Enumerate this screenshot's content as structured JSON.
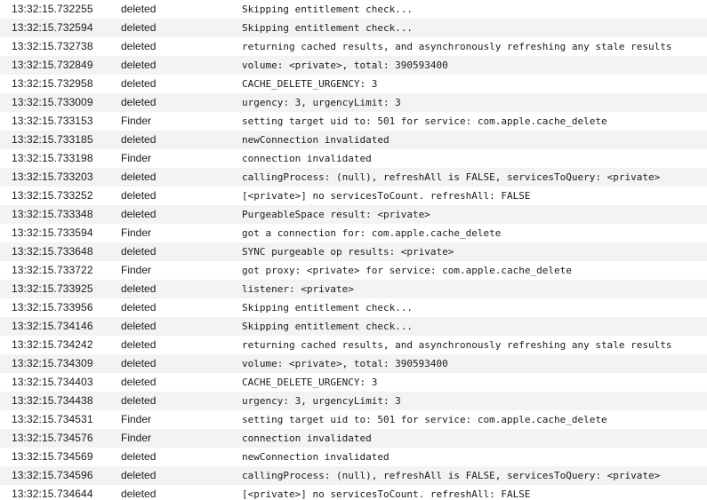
{
  "colors": {
    "row_even": "#ffffff",
    "row_odd": "#f3f3f3",
    "text": "#1a1a1a"
  },
  "log": {
    "rows": [
      {
        "time": "13:32:15.732255",
        "process": "deleted",
        "message": "Skipping entitlement check..."
      },
      {
        "time": "13:32:15.732594",
        "process": "deleted",
        "message": "Skipping entitlement check..."
      },
      {
        "time": "13:32:15.732738",
        "process": "deleted",
        "message": "returning cached results, and asynchronously refreshing any stale results"
      },
      {
        "time": "13:32:15.732849",
        "process": "deleted",
        "message": "volume: <private>, total: 390593400"
      },
      {
        "time": "13:32:15.732958",
        "process": "deleted",
        "message": "CACHE_DELETE_URGENCY: 3"
      },
      {
        "time": "13:32:15.733009",
        "process": "deleted",
        "message": "urgency: 3, urgencyLimit: 3"
      },
      {
        "time": "13:32:15.733153",
        "process": "Finder",
        "message": "setting target uid to: 501 for service: com.apple.cache_delete"
      },
      {
        "time": "13:32:15.733185",
        "process": "deleted",
        "message": "newConnection invalidated"
      },
      {
        "time": "13:32:15.733198",
        "process": "Finder",
        "message": "connection invalidated"
      },
      {
        "time": "13:32:15.733203",
        "process": "deleted",
        "message": "callingProcess: (null), refreshAll is FALSE, servicesToQuery: <private>"
      },
      {
        "time": "13:32:15.733252",
        "process": "deleted",
        "message": "[<private>] no servicesToCount. refreshAll: FALSE"
      },
      {
        "time": "13:32:15.733348",
        "process": "deleted",
        "message": "PurgeableSpace result: <private>"
      },
      {
        "time": "13:32:15.733594",
        "process": "Finder",
        "message": "got a connection for: com.apple.cache_delete"
      },
      {
        "time": "13:32:15.733648",
        "process": "deleted",
        "message": "SYNC purgeable op results: <private>"
      },
      {
        "time": "13:32:15.733722",
        "process": "Finder",
        "message": "got proxy: <private> for service: com.apple.cache_delete"
      },
      {
        "time": "13:32:15.733925",
        "process": "deleted",
        "message": "listener: <private>"
      },
      {
        "time": "13:32:15.733956",
        "process": "deleted",
        "message": "Skipping entitlement check..."
      },
      {
        "time": "13:32:15.734146",
        "process": "deleted",
        "message": "Skipping entitlement check..."
      },
      {
        "time": "13:32:15.734242",
        "process": "deleted",
        "message": "returning cached results, and asynchronously refreshing any stale results"
      },
      {
        "time": "13:32:15.734309",
        "process": "deleted",
        "message": "volume: <private>, total: 390593400"
      },
      {
        "time": "13:32:15.734403",
        "process": "deleted",
        "message": "CACHE_DELETE_URGENCY: 3"
      },
      {
        "time": "13:32:15.734438",
        "process": "deleted",
        "message": "urgency: 3, urgencyLimit: 3"
      },
      {
        "time": "13:32:15.734531",
        "process": "Finder",
        "message": "setting target uid to: 501 for service: com.apple.cache_delete"
      },
      {
        "time": "13:32:15.734576",
        "process": "Finder",
        "message": "connection invalidated"
      },
      {
        "time": "13:32:15.734569",
        "process": "deleted",
        "message": "newConnection invalidated"
      },
      {
        "time": "13:32:15.734596",
        "process": "deleted",
        "message": "callingProcess: (null), refreshAll is FALSE, servicesToQuery: <private>"
      },
      {
        "time": "13:32:15.734644",
        "process": "deleted",
        "message": "[<private>] no servicesToCount. refreshAll: FALSE"
      }
    ]
  }
}
